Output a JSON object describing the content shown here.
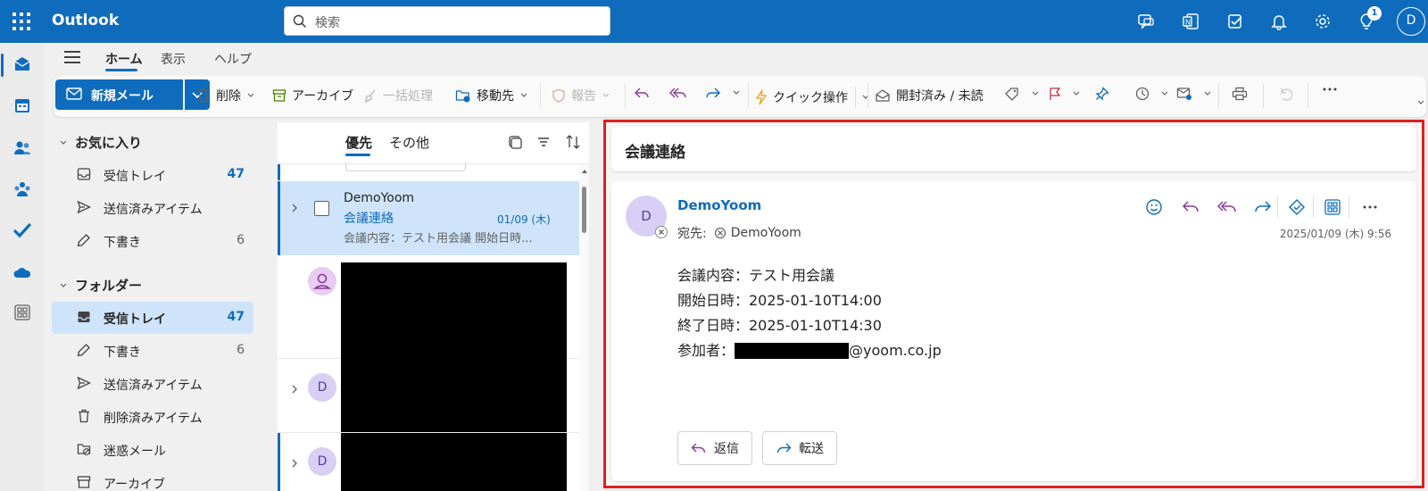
{
  "app": {
    "name": "Outlook"
  },
  "search": {
    "placeholder": "検索"
  },
  "topbar": {
    "notification_count": "1",
    "user_initial": "D"
  },
  "ribbon": {
    "tabs": [
      "ホーム",
      "表示",
      "ヘルプ"
    ],
    "new_mail": "新規メール",
    "delete": "削除",
    "archive": "アーカイブ",
    "sweep": "一括処理",
    "move": "移動先",
    "report": "報告",
    "quick_steps": "クイック操作",
    "read_unread": "開封済み / 未読"
  },
  "folders": {
    "favorites_title": "お気に入り",
    "favorites": [
      {
        "label": "受信トレイ",
        "count": "47"
      },
      {
        "label": "送信済みアイテム",
        "count": ""
      },
      {
        "label": "下書き",
        "count": "6"
      }
    ],
    "folders_title": "フォルダー",
    "items": [
      {
        "label": "受信トレイ",
        "count": "47"
      },
      {
        "label": "下書き",
        "count": "6"
      },
      {
        "label": "送信済みアイテム",
        "count": ""
      },
      {
        "label": "削除済みアイテム",
        "count": ""
      },
      {
        "label": "迷惑メール",
        "count": ""
      },
      {
        "label": "アーカイブ",
        "count": ""
      }
    ]
  },
  "message_list": {
    "tabs": [
      "優先",
      "その他"
    ],
    "selected": {
      "sender": "DemoYoom",
      "subject": "会議連絡",
      "date": "01/09 (木)",
      "preview": "会議内容：テスト用会議 開始日時..."
    },
    "other_avatars": [
      "D",
      "D"
    ]
  },
  "reading": {
    "subject": "会議連絡",
    "avatar": "D",
    "from": "DemoYoom",
    "to_label": "宛先:",
    "to": "DemoYoom",
    "date": "2025/01/09 (木) 9:56",
    "body": [
      "会議内容：テスト用会議",
      "開始日時：2025-01-10T14:00",
      "終了日時：2025-01-10T14:30"
    ],
    "participant_label": "参加者：",
    "participant_domain": "@yoom.co.jp",
    "reply": "返信",
    "forward": "転送"
  }
}
